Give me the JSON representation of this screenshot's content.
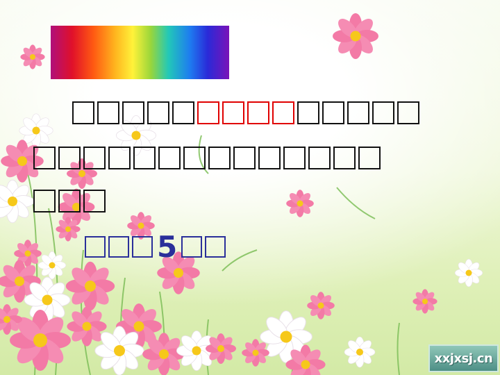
{
  "slide": {
    "line1_black_before": 5,
    "line1_red": 4,
    "line1_black_after": 5,
    "line2_boxes": 14,
    "line3_boxes": 3,
    "line4_before": 3,
    "line4_number": "5",
    "line4_after": 2
  },
  "colors": {
    "black_box": "#111111",
    "red_box": "#e00000",
    "blue_text": "#2a2f9a",
    "flower_pink": "#f37aa6",
    "flower_white": "#ffffff",
    "flower_center": "#f6c81a"
  },
  "watermark": {
    "text": "xxjxsj.cn"
  }
}
